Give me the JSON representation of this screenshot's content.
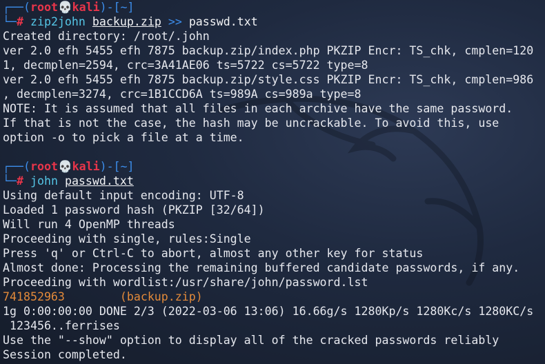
{
  "prompt1": {
    "top_open": "┌──(",
    "user": "root",
    "skull": "💀",
    "host": "kali",
    "dir_seg": ")-[~]",
    "bottom": "└─",
    "hash": "#",
    "command": "zip2john",
    "arg": "backup.zip",
    "redirect": ">>",
    "outfile": "passwd.txt"
  },
  "output1": [
    "Created directory: /root/.john",
    "ver 2.0 efh 5455 efh 7875 backup.zip/index.php PKZIP Encr: TS_chk, cmplen=120",
    "1, decmplen=2594, crc=3A41AE06 ts=5722 cs=5722 type=8",
    "ver 2.0 efh 5455 efh 7875 backup.zip/style.css PKZIP Encr: TS_chk, cmplen=986",
    ", decmplen=3274, crc=1B1CCD6A ts=989A cs=989a type=8",
    "NOTE: It is assumed that all files in each archive have the same password.",
    "If that is not the case, the hash may be uncrackable. To avoid this, use",
    "option -o to pick a file at a time."
  ],
  "prompt2": {
    "top_open": "┌──(",
    "user": "root",
    "skull": "💀",
    "host": "kali",
    "dir_seg": ")-[~]",
    "bottom": "└─",
    "hash": "#",
    "command": "john",
    "arg": "passwd.txt"
  },
  "output2": [
    "Using default input encoding: UTF-8",
    "Loaded 1 password hash (PKZIP [32/64])",
    "Will run 4 OpenMP threads",
    "Proceeding with single, rules:Single",
    "Press 'q' or Ctrl-C to abort, almost any other key for status",
    "Almost done: Processing the remaining buffered candidate passwords, if any.",
    "Proceeding with wordlist:/usr/share/john/password.lst"
  ],
  "cracked": {
    "password": "741852963",
    "source": "(backup.zip)"
  },
  "output3": [
    "1g 0:00:00:00 DONE 2/3 (2022-03-06 13:06) 16.66g/s 1280Kp/s 1280Kc/s 1280KC/s",
    " 123456..ferrises",
    "Use the \"--show\" option to display all of the cracked passwords reliably",
    "Session completed."
  ],
  "colors": {
    "background": "#1b2333",
    "prompt_blue": "#3c8dea",
    "prompt_red": "#e8354a",
    "command_cyan": "#55c6e6",
    "cracked_orange": "#e38a3a",
    "text": "#e6e8ee"
  }
}
